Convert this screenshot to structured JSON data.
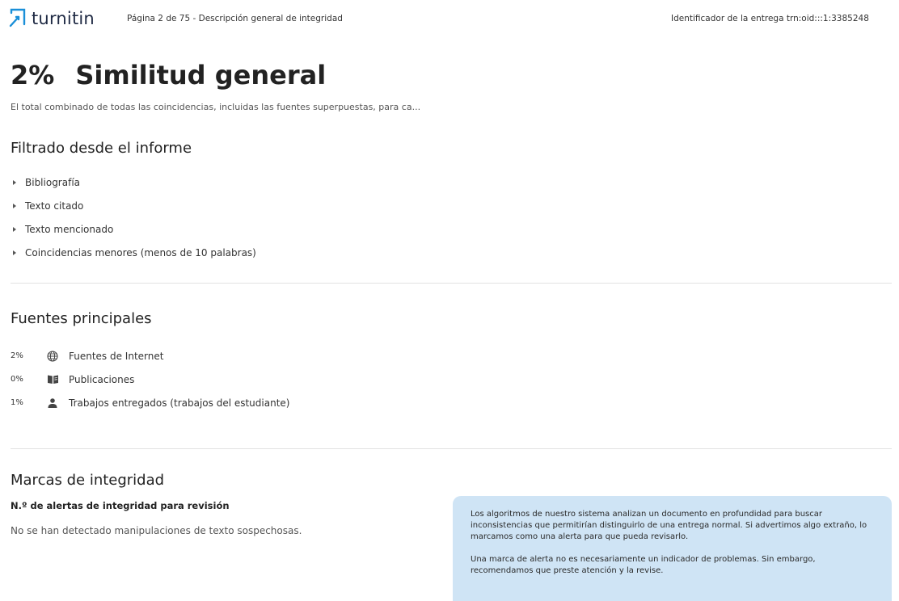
{
  "header": {
    "logo_text": "turnitin",
    "page_info": "Página 2 de 75 - Descripción general de integridad",
    "submission_id": "Identificador de la entrega   trn:oid:::1:3385248"
  },
  "overview": {
    "percentage": "2%",
    "title": "Similitud general",
    "subtitle": "El total combinado de todas las coincidencias, incluidas las fuentes superpuestas, para ca..."
  },
  "filtered": {
    "title": "Filtrado desde el informe",
    "items": [
      "Bibliografía",
      "Texto citado",
      "Texto mencionado",
      "Coincidencias menores (menos de 10 palabras)"
    ]
  },
  "sources": {
    "title": "Fuentes principales",
    "items": [
      {
        "pct": "2%",
        "label": "Fuentes de Internet",
        "icon": "globe-icon"
      },
      {
        "pct": "0%",
        "label": "Publicaciones",
        "icon": "book-icon"
      },
      {
        "pct": "1%",
        "label": "Trabajos entregados (trabajos del estudiante)",
        "icon": "person-icon"
      }
    ]
  },
  "integrity": {
    "title": "Marcas de integridad",
    "alerts_label": "N.º de alertas de integridad para revisión",
    "alerts_text": "No se han detectado manipulaciones de texto sospechosas.",
    "info_p1": "Los algoritmos de nuestro sistema analizan un documento en profundidad para buscar inconsistencias que permitirían distinguirlo de una entrega normal. Si advertimos algo extraño, lo marcamos como una alerta para que pueda revisarlo.",
    "info_p2": "Una marca de alerta no es necesariamente un indicador de problemas. Sin embargo, recomendamos que preste atención y la revise."
  },
  "colors": {
    "brand": "#1a8fd8",
    "info_box": "#cfe4f5"
  }
}
